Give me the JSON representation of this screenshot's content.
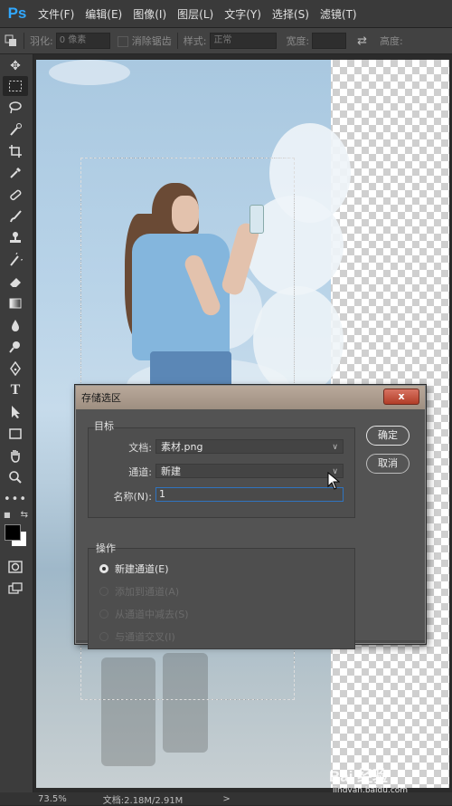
{
  "app": {
    "logo": "Ps"
  },
  "menu": [
    "文件(F)",
    "编辑(E)",
    "图像(I)",
    "图层(L)",
    "文字(Y)",
    "选择(S)",
    "滤镜(T)"
  ],
  "options_bar": {
    "feather_label": "羽化:",
    "feather_value": "0 像素",
    "antialias_label": "消除锯齿",
    "style_label": "样式:",
    "style_value": "正常",
    "width_label": "宽度:",
    "height_label": "高度:",
    "swap_icon": "swap-arrows-icon"
  },
  "tools": [
    "move-icon",
    "marquee-icon",
    "lasso-icon",
    "quick-select-icon",
    "crop-icon",
    "eyedropper-icon",
    "healing-icon",
    "brush-icon",
    "stamp-icon",
    "history-brush-icon",
    "eraser-icon",
    "gradient-icon",
    "blur-icon",
    "dodge-icon",
    "pen-icon",
    "type-icon",
    "path-select-icon",
    "rectangle-icon",
    "hand-icon",
    "zoom-icon",
    "more-icon",
    "swap-colors-icon",
    "foreground-color",
    "quick-mask-icon",
    "screen-mode-icon"
  ],
  "dialog": {
    "title": "存储选区",
    "close_label": "x",
    "target_group": "目标",
    "document_label": "文档:",
    "document_value": "素材.png",
    "channel_label": "通道:",
    "channel_value": "新建",
    "name_label": "名称(N):",
    "name_value": "1",
    "ok_label": "确定",
    "cancel_label": "取消",
    "operation_group": "操作",
    "operations": [
      {
        "label": "新建通道(E)",
        "selected": true,
        "enabled": true
      },
      {
        "label": "添加到通道(A)",
        "selected": false,
        "enabled": false
      },
      {
        "label": "从通道中减去(S)",
        "selected": false,
        "enabled": false
      },
      {
        "label": "与通道交叉(I)",
        "selected": false,
        "enabled": false
      }
    ]
  },
  "status": {
    "zoom": "73.5%",
    "doc_info": "文档:2.18M/2.91M",
    "arrow": ">"
  },
  "watermark": {
    "text": "Bai 经验",
    "sub": "jingyan.baidu.com"
  }
}
